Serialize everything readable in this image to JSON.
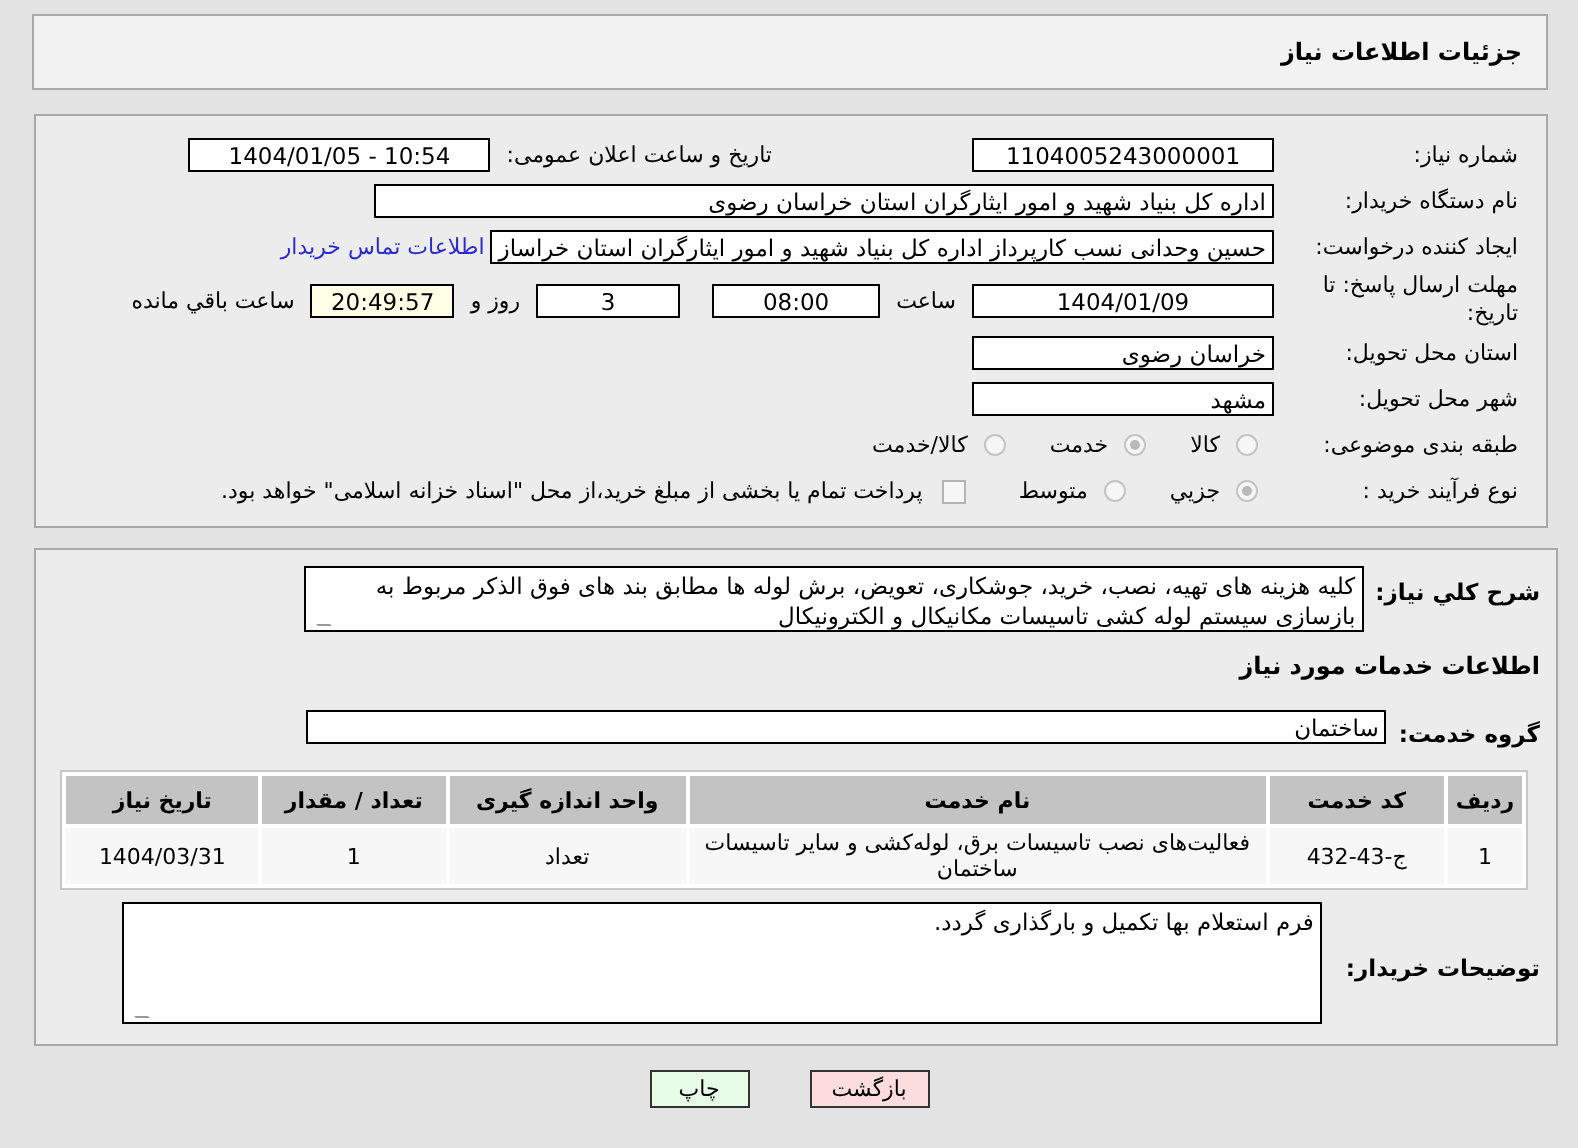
{
  "header": {
    "title": "جزئیات اطلاعات نیاز"
  },
  "need_number": {
    "label": "شماره نیاز:",
    "value": "1104005243000001"
  },
  "announce": {
    "label": "تاریخ و ساعت اعلان عمومی:",
    "value": "1404/01/05 - 10:54"
  },
  "buyer": {
    "label": "نام دستگاه خریدار:",
    "value": "اداره کل بنیاد شهید و امور ایثارگران استان خراسان رضوی"
  },
  "requester": {
    "label": "ایجاد کننده درخواست:",
    "value": "حسین وحدانی نسب کارپرداز اداره کل بنیاد شهید و امور ایثارگران استان خراساز",
    "link": "اطلاعات تماس خریدار"
  },
  "deadline": {
    "label": "مهلت ارسال پاسخ: تا تاریخ:",
    "date": "1404/01/09",
    "time_label": "ساعت",
    "time": "08:00",
    "days": "3",
    "days_label": "روز و",
    "remaining": "20:49:57",
    "remaining_label": "ساعت باقي مانده"
  },
  "province": {
    "label": "استان محل تحویل:",
    "value": "خراسان رضوی"
  },
  "city": {
    "label": "شهر محل تحویل:",
    "value": "مشهد"
  },
  "category": {
    "label": "طبقه بندی موضوعی:",
    "options": [
      {
        "label": "کالا",
        "selected": false
      },
      {
        "label": "خدمت",
        "selected": true
      },
      {
        "label": "کالا/خدمت",
        "selected": false
      }
    ]
  },
  "purchase_type": {
    "label": "نوع فرآیند خرید :",
    "options": [
      {
        "label": "جزیي",
        "selected": true
      },
      {
        "label": "متوسط",
        "selected": false
      }
    ],
    "treasury": {
      "checked": false,
      "text": "پرداخت تمام یا بخشی از مبلغ خرید،از محل \"اسناد خزانه اسلامی\" خواهد بود."
    }
  },
  "description": {
    "label": "شرح کلي نیاز:",
    "value": "کلیه هزینه های تهیه، نصب، خرید، جوشکاری، تعویض، برش لوله ها مطابق بند های فوق الذکر مربوط به بازسازی سیستم لوله کشی تاسیسات مکانیکال و الکترونیکال"
  },
  "services_heading": "اطلاعات خدمات مورد نیاز",
  "service_group": {
    "label": "گروه خدمت:",
    "value": "ساختمان"
  },
  "table": {
    "columns": [
      "ردیف",
      "کد خدمت",
      "نام خدمت",
      "واحد اندازه گیری",
      "تعداد / مقدار",
      "تاریخ نیاز"
    ],
    "rows": [
      [
        "1",
        "ج-43-432",
        "فعالیت‌های نصب تاسیسات برق، لوله‌کشی و سایر تاسیسات ساختمان",
        "تعداد",
        "1",
        "1404/03/31"
      ]
    ]
  },
  "buyer_notes": {
    "label": "توضیحات خریدار:",
    "value": "فرم استعلام بها تکمیل و بارگذاری گردد."
  },
  "buttons": [
    {
      "label": "بازگشت",
      "kind": "back"
    },
    {
      "label": "چاپ",
      "kind": "print"
    }
  ]
}
